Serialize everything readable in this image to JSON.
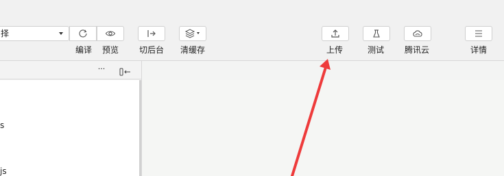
{
  "toolbar": {
    "compile_mode_value": "择",
    "compile_label": "编译",
    "preview_label": "预览",
    "backend_label": "切后台",
    "clear_cache_label": "清缓存",
    "upload_label": "上传",
    "test_label": "测试",
    "cloud_label": "腾讯云",
    "details_label": "详情"
  },
  "file_panel": {
    "more_label": "···",
    "file_fragment_1": "s",
    "file_fragment_2": "js"
  },
  "annotation": {
    "arrow_color": "#ee3b3b"
  }
}
